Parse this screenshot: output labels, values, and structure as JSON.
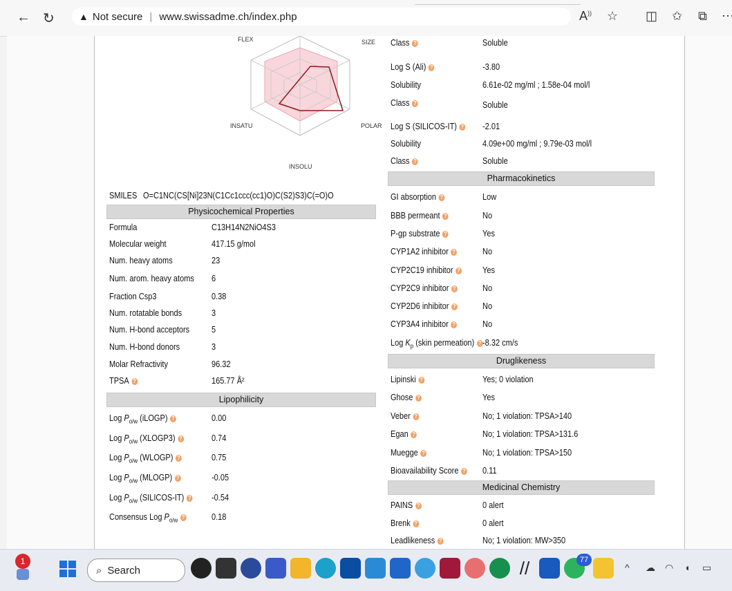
{
  "browser": {
    "security": "Not secure",
    "url": "www.swissadme.ch/index.php"
  },
  "radar": {
    "labels": {
      "flex": "FLEX",
      "size": "SIZE",
      "insatu": "INSATU",
      "polar": "POLAR",
      "insolu": "INSOLU"
    }
  },
  "smiles": {
    "label": "SMILES",
    "value": "O=C1NC(CS[Ni]23N(C1Cc1ccc(cc1)O)C(S2)S3)C(=O)O"
  },
  "physchem": {
    "header": "Physicochemical Properties",
    "rows": [
      {
        "label": "Formula",
        "value": "C13H14N2NiO4S3"
      },
      {
        "label": "Molecular weight",
        "value": "417.15 g/mol"
      },
      {
        "label": "Num. heavy atoms",
        "value": "23"
      },
      {
        "label": "Num. arom. heavy atoms",
        "value": "6"
      },
      {
        "label": "Fraction Csp3",
        "value": "0.38"
      },
      {
        "label": "Num. rotatable bonds",
        "value": "3"
      },
      {
        "label": "Num. H-bond acceptors",
        "value": "5"
      },
      {
        "label": "Num. H-bond donors",
        "value": "3"
      },
      {
        "label": "Molar Refractivity",
        "value": "96.32"
      },
      {
        "label": "TPSA",
        "value": "165.77 Å²"
      }
    ]
  },
  "lipophilicity": {
    "header": "Lipophilicity",
    "log_prefix": "Log ",
    "p_sym": "P",
    "ow_sub": "o/w",
    "consensus_prefix": "Consensus Log ",
    "rows": [
      {
        "method": " (iLOGP)",
        "value": "0.00"
      },
      {
        "method": " (XLOGP3)",
        "value": "0.74"
      },
      {
        "method": " (WLOGP)",
        "value": "0.75"
      },
      {
        "method": " (MLOGP)",
        "value": "-0.05"
      },
      {
        "method": " (SILICOS-IT)",
        "value": "-0.54"
      }
    ],
    "consensus_value": "0.18"
  },
  "solubility": {
    "class1_label": "Class",
    "class1_value": "Soluble",
    "ali_label": "Log S (Ali)",
    "ali_value": "-3.80",
    "sol_label": "Solubility",
    "ali_sol": "6.61e-02 mg/ml ; 1.58e-04 mol/l",
    "class2_label": "Class",
    "class2_value": "Soluble",
    "silicos_label": "Log S (SILICOS-IT)",
    "silicos_value": "-2.01",
    "silicos_sol": "4.09e+00 mg/ml ; 9.79e-03 mol/l",
    "class3_label": "Class",
    "class3_value": "Soluble"
  },
  "pharmacokinetics": {
    "header": "Pharmacokinetics",
    "rows": [
      {
        "label": "GI absorption",
        "value": "Low"
      },
      {
        "label": "BBB permeant",
        "value": "No"
      },
      {
        "label": "P-gp substrate",
        "value": "Yes"
      },
      {
        "label": "CYP1A2 inhibitor",
        "value": "No"
      },
      {
        "label": "CYP2C19 inhibitor",
        "value": "Yes"
      },
      {
        "label": "CYP2C9 inhibitor",
        "value": "No"
      },
      {
        "label": "CYP2D6 inhibitor",
        "value": "No"
      },
      {
        "label": "CYP3A4 inhibitor",
        "value": "No"
      }
    ],
    "kp_prefix": "Log ",
    "kp_sym": "K",
    "kp_sub": "p",
    "kp_suffix": " (skin permeation)",
    "kp_value": "-8.32 cm/s"
  },
  "druglikeness": {
    "header": "Druglikeness",
    "rows": [
      {
        "label": "Lipinski",
        "value": "Yes; 0 violation"
      },
      {
        "label": "Ghose",
        "value": "Yes"
      },
      {
        "label": "Veber",
        "value": "No; 1 violation: TPSA>140"
      },
      {
        "label": "Egan",
        "value": "No; 1 violation: TPSA>131.6"
      },
      {
        "label": "Muegge",
        "value": "No; 1 violation: TPSA>150"
      },
      {
        "label": "Bioavailability Score",
        "value": "0.11"
      }
    ]
  },
  "medchem": {
    "header": "Medicinal Chemistry",
    "rows": [
      {
        "label": "PAINS",
        "value": "0 alert"
      },
      {
        "label": "Brenk",
        "value": "0 alert"
      },
      {
        "label": "Leadlikeness",
        "value": "No; 1 violation: MW>350"
      }
    ]
  },
  "taskbar": {
    "search_label": "Search",
    "notif_count": "1",
    "whatsapp_count": "77"
  }
}
